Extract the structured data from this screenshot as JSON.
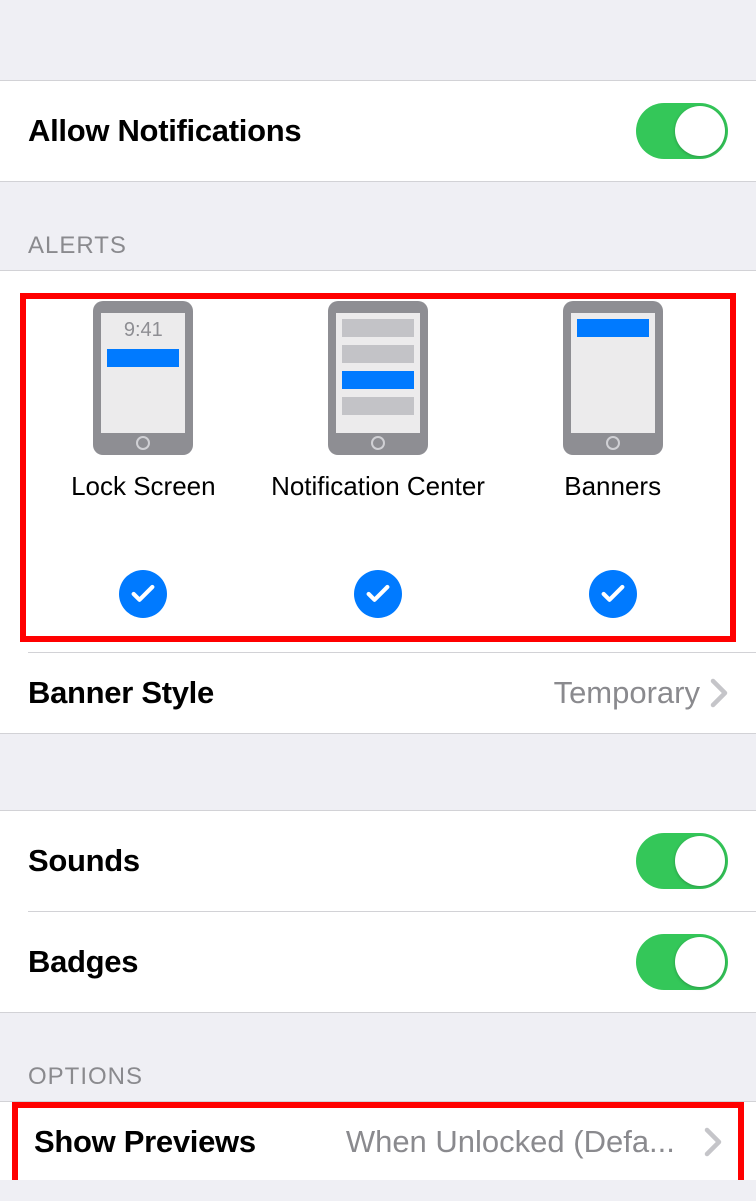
{
  "allowNotifications": {
    "label": "Allow Notifications",
    "enabled": true
  },
  "alertsHeader": "ALERTS",
  "alerts": {
    "lockScreen": {
      "label": "Lock Screen",
      "checked": true,
      "time": "9:41"
    },
    "notificationCenter": {
      "label": "Notification Center",
      "checked": true
    },
    "banners": {
      "label": "Banners",
      "checked": true
    }
  },
  "bannerStyle": {
    "label": "Banner Style",
    "value": "Temporary"
  },
  "sounds": {
    "label": "Sounds",
    "enabled": true
  },
  "badges": {
    "label": "Badges",
    "enabled": true
  },
  "optionsHeader": "OPTIONS",
  "showPreviews": {
    "label": "Show Previews",
    "value": "When Unlocked (Defa..."
  },
  "colors": {
    "accent": "#007aff",
    "toggleOn": "#34c759",
    "highlight": "#ff0000"
  }
}
